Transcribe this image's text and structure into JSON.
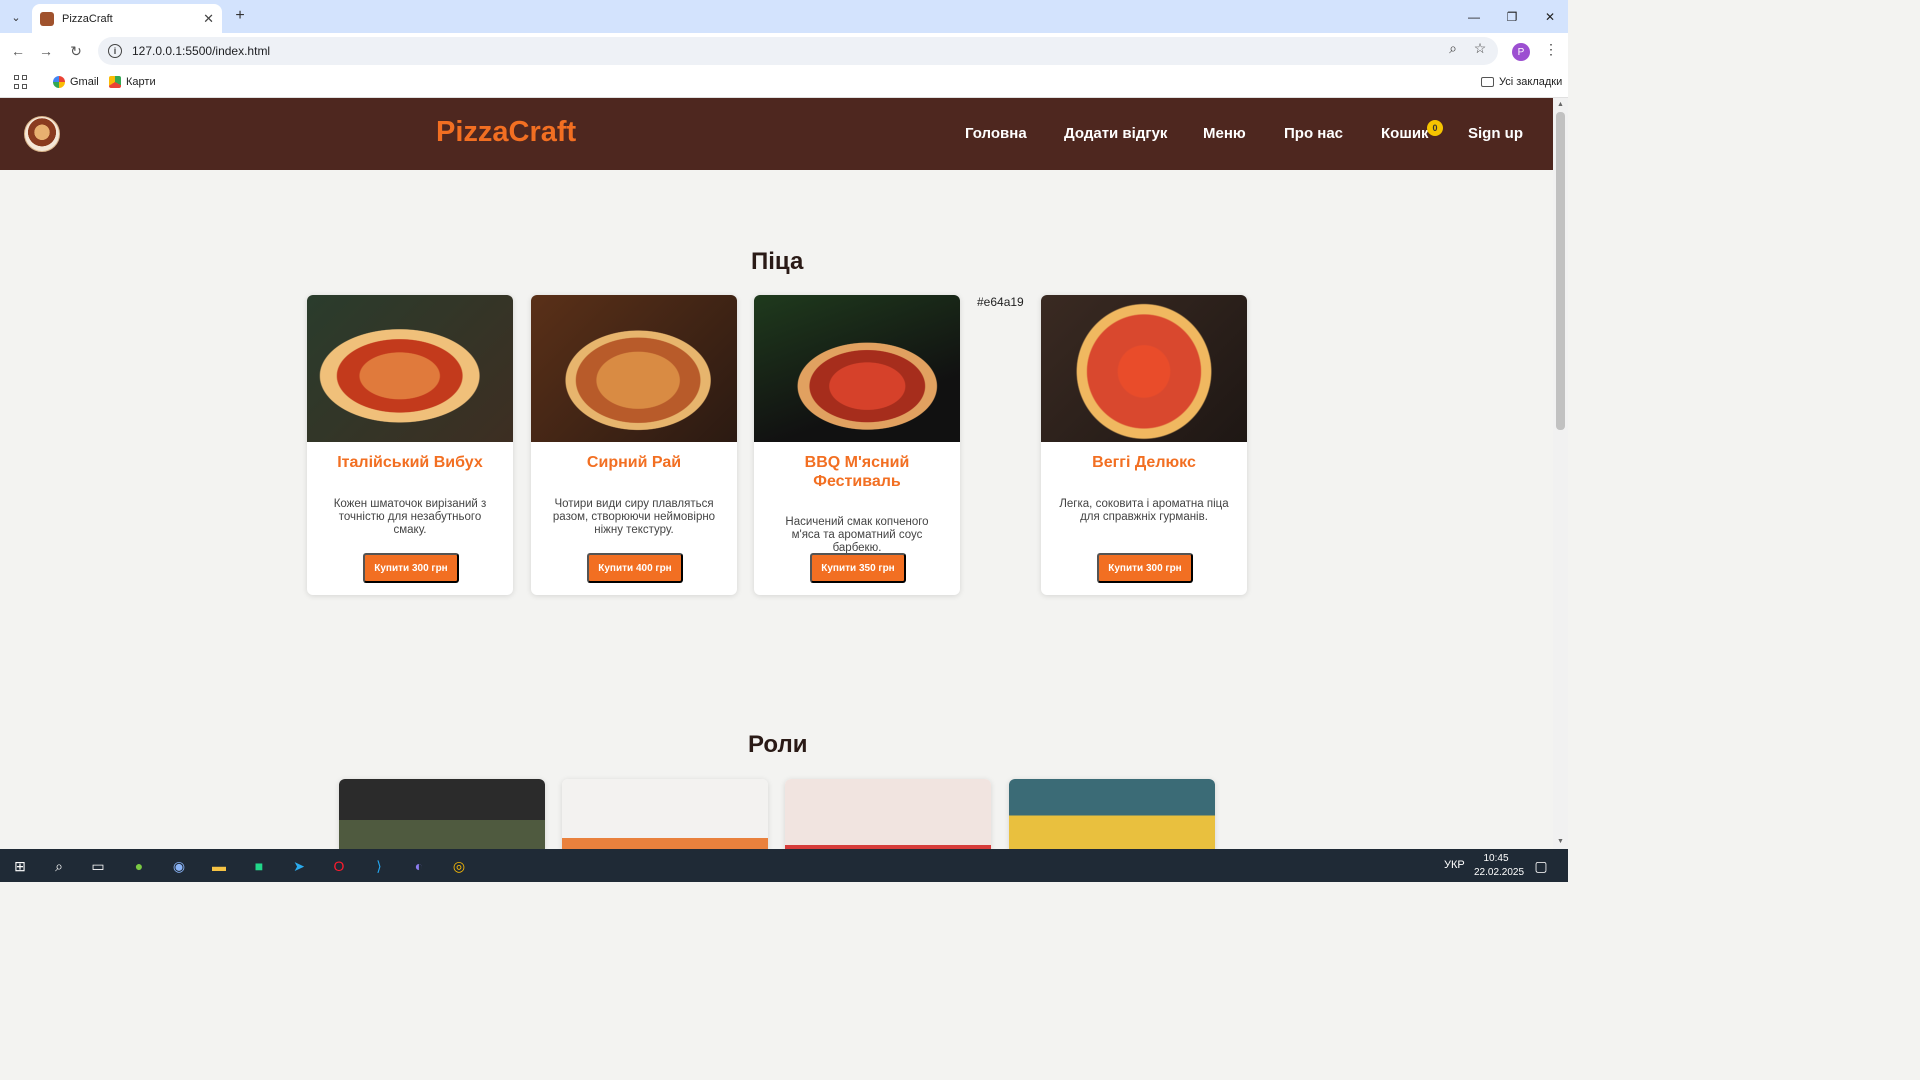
{
  "browser": {
    "tab_title": "PizzaCraft",
    "url": "127.0.0.1:5500/index.html",
    "profile_initial": "P",
    "bookmarks": [
      {
        "label": "Gmail"
      },
      {
        "label": "Карти"
      }
    ],
    "all_bookmarks": "Усі закладки"
  },
  "site": {
    "brand": "PizzaCraft",
    "nav": [
      "Головна",
      "Додати відгук",
      "Меню",
      "Про нас",
      "Кошик",
      "Sign up"
    ],
    "cart_count": "0"
  },
  "sections": {
    "pizza_title": "Піца",
    "rolls_title": "Роли",
    "hex_note": "#e64a19"
  },
  "pizzas": [
    {
      "name": "Італійський Вибух",
      "desc": "Кожен шматочок вирізаний з точністю для незабутнього смаку.",
      "buy": "Купити 300 грн"
    },
    {
      "name": "Сирний Рай",
      "desc": "Чотири види сиру плавляться разом, створюючи неймовірно ніжну текстуру.",
      "buy": "Купити 400 грн"
    },
    {
      "name": "BBQ М'ясний Фестиваль",
      "desc": "Насичений смак копченого м'яса та ароматний соус барбекю.",
      "buy": "Купити 350 грн"
    },
    {
      "name": "Веггі Делюкс",
      "desc": "Легка, соковита і ароматна піца для справжніх гурманів.",
      "buy": "Купити 300 грн"
    }
  ],
  "taskbar": {
    "language": "УКР",
    "time": "10:45",
    "date": "22.02.2025"
  },
  "colors": {
    "header_bg": "#4e271f",
    "accent": "#f26f22",
    "badge": "#f5c400"
  }
}
